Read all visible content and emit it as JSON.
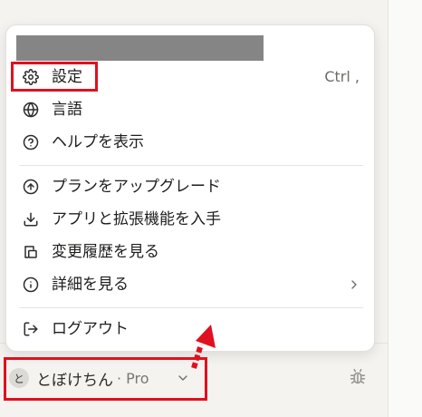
{
  "menu": {
    "items": [
      {
        "label": "設定",
        "shortcut": "Ctrl ,",
        "icon": "gear-icon"
      },
      {
        "label": "言語",
        "icon": "globe-icon"
      },
      {
        "label": "ヘルプを表示",
        "icon": "help-circle-icon"
      },
      {
        "label": "プランをアップグレード",
        "icon": "arrow-up-circle-icon"
      },
      {
        "label": "アプリと拡張機能を入手",
        "icon": "download-icon"
      },
      {
        "label": "変更履歴を見る",
        "icon": "changelog-icon"
      },
      {
        "label": "詳細を見る",
        "icon": "info-circle-icon"
      },
      {
        "label": "ログアウト",
        "icon": "logout-icon"
      }
    ]
  },
  "user": {
    "avatar_initial": "と",
    "name": "とぼけちん",
    "plan": "· Pro"
  },
  "colors": {
    "highlight": "#e0101e",
    "menu_bg": "#ffffff",
    "redaction": "#858585"
  }
}
